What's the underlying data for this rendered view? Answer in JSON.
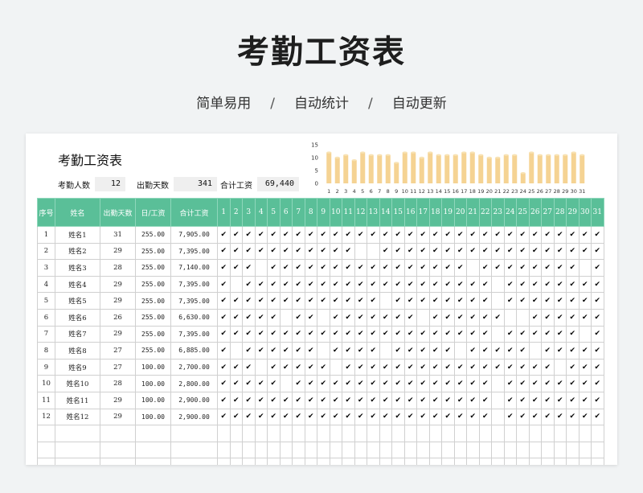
{
  "banner": {
    "title": "考勤工资表",
    "features": [
      "简单易用",
      "自动统计",
      "自动更新"
    ],
    "separator": "/"
  },
  "sheet": {
    "title": "考勤工资表",
    "summary": {
      "headcount_label": "考勤人数",
      "headcount_value": "12",
      "days_label": "出勤天数",
      "days_value": "341",
      "total_label": "合计工资",
      "total_value": "69,440"
    },
    "columns": {
      "seq": "序号",
      "name": "姓名",
      "days": "出勤天数",
      "daily": "日/工资",
      "total": "合计工资"
    },
    "check_mark": "✔",
    "employees": [
      {
        "seq": "1",
        "name": "姓名1",
        "days": "31",
        "daily": "255.00",
        "total": "7,905.00",
        "attendance": "1111111111111111111111111111111"
      },
      {
        "seq": "2",
        "name": "姓名2",
        "days": "29",
        "daily": "255.00",
        "total": "7,395.00",
        "attendance": "1111111111100111111111111111111"
      },
      {
        "seq": "3",
        "name": "姓名3",
        "days": "28",
        "daily": "255.00",
        "total": "7,140.00",
        "attendance": "1110111111111111111101111111101"
      },
      {
        "seq": "4",
        "name": "姓名4",
        "days": "29",
        "daily": "255.00",
        "total": "7,395.00",
        "attendance": "1011111111111111111111011111111"
      },
      {
        "seq": "5",
        "name": "姓名5",
        "days": "29",
        "daily": "255.00",
        "total": "7,395.00",
        "attendance": "1111111111111011111111011111111"
      },
      {
        "seq": "6",
        "name": "姓名6",
        "days": "26",
        "daily": "255.00",
        "total": "6,630.00",
        "attendance": "1111101101111111011111100111111"
      },
      {
        "seq": "7",
        "name": "姓名7",
        "days": "29",
        "daily": "255.00",
        "total": "7,395.00",
        "attendance": "1111111111111111111111011111101"
      },
      {
        "seq": "8",
        "name": "姓名8",
        "days": "27",
        "daily": "255.00",
        "total": "6,885.00",
        "attendance": "1011111101111011111011111011111"
      },
      {
        "seq": "9",
        "name": "姓名9",
        "days": "27",
        "daily": "100.00",
        "total": "2,700.00",
        "attendance": "1110111110111111111111111110111"
      },
      {
        "seq": "10",
        "name": "姓名10",
        "days": "28",
        "daily": "100.00",
        "total": "2,800.00",
        "attendance": "1111101111111111111111011111111"
      },
      {
        "seq": "11",
        "name": "姓名11",
        "days": "29",
        "daily": "100.00",
        "total": "2,900.00",
        "attendance": "1111111111111111111111011111111"
      },
      {
        "seq": "12",
        "name": "姓名12",
        "days": "29",
        "daily": "100.00",
        "total": "2,900.00",
        "attendance": "1111111111111111111111011111111"
      }
    ],
    "blank_rows": 3
  },
  "chart_data": {
    "type": "bar",
    "categories": [
      "1",
      "2",
      "3",
      "4",
      "5",
      "6",
      "7",
      "8",
      "9",
      "10",
      "11",
      "12",
      "13",
      "14",
      "15",
      "16",
      "17",
      "18",
      "19",
      "20",
      "21",
      "22",
      "23",
      "24",
      "25",
      "26",
      "27",
      "28",
      "29",
      "30",
      "31"
    ],
    "values": [
      12,
      10,
      11,
      9,
      12,
      11,
      11,
      11,
      8,
      12,
      12,
      10,
      12,
      11,
      11,
      11,
      12,
      12,
      11,
      10,
      10,
      11,
      11,
      4,
      12,
      11,
      11,
      11,
      11,
      12,
      11
    ],
    "ylim": [
      0,
      15
    ],
    "yticks": [
      "0",
      "5",
      "10",
      "15"
    ],
    "bar_color": "#f5d393"
  }
}
